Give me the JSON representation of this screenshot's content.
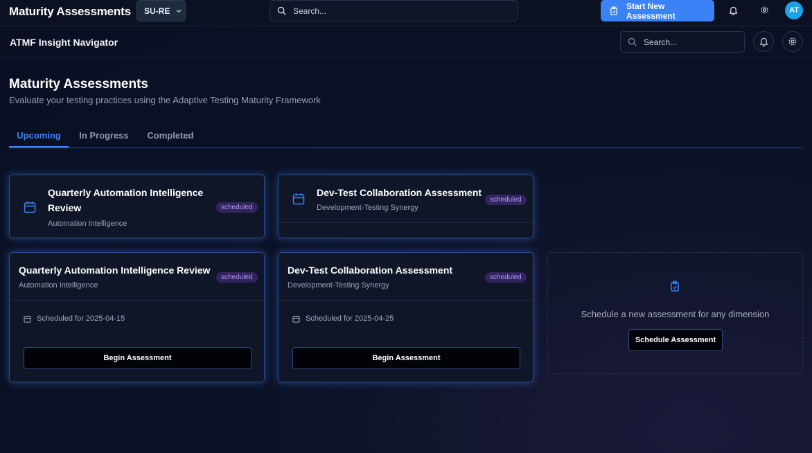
{
  "topbar": {
    "app_title": "Maturity Assessments",
    "project_selector": "SU-RE",
    "search_placeholder": "Search...",
    "start_button": "Start New Assessment",
    "avatar_initials": "AT"
  },
  "subbar": {
    "title": "ATMF Insight Navigator",
    "search_placeholder": "Search..."
  },
  "page": {
    "title": "Maturity Assessments",
    "subtitle": "Evaluate your testing practices using the Adaptive Testing Maturity Framework"
  },
  "tabs": [
    {
      "label": "Upcoming",
      "active": true
    },
    {
      "label": "In Progress",
      "active": false
    },
    {
      "label": "Completed",
      "active": false
    }
  ],
  "compact_cards": [
    {
      "title": "Quarterly Automation Intelligence Review",
      "dimension": "Automation Intelligence",
      "status": "scheduled"
    },
    {
      "title": "Dev-Test Collaboration Assessment",
      "dimension": "Development-Testing Synergy",
      "status": "scheduled"
    }
  ],
  "detail_cards": [
    {
      "title": "Quarterly Automation Intelligence Review",
      "dimension": "Automation Intelligence",
      "status": "scheduled",
      "scheduled_text": "Scheduled for 2025-04-15",
      "action": "Begin Assessment"
    },
    {
      "title": "Dev-Test Collaboration Assessment",
      "dimension": "Development-Testing Synergy",
      "status": "scheduled",
      "scheduled_text": "Scheduled for 2025-04-25",
      "action": "Begin Assessment"
    }
  ],
  "empty_state": {
    "text": "Schedule a new assessment for any dimension",
    "button": "Schedule Assessment"
  },
  "colors": {
    "accent": "#3b82f6",
    "badge_bg": "#33245e",
    "badge_text": "#b49cf7",
    "avatar": "#1da1e6"
  },
  "icons": [
    "search-icon",
    "chevron-down-icon",
    "clipboard-icon",
    "bell-icon",
    "gear-icon",
    "calendar-icon"
  ]
}
